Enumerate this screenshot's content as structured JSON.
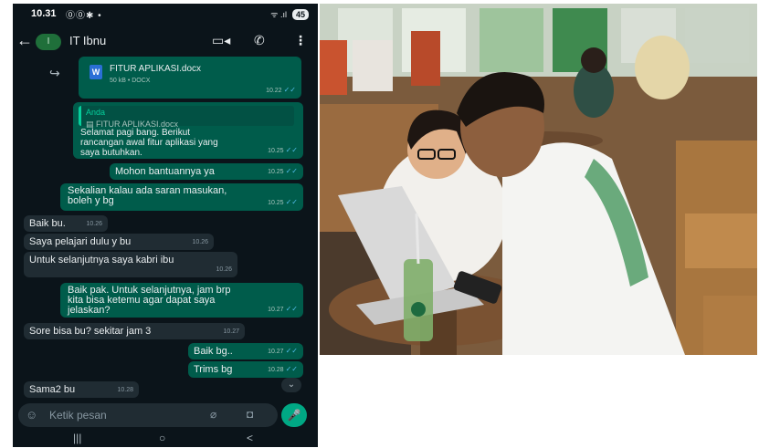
{
  "status_bar": {
    "time": "10.31",
    "icons": "⓪⓪✱ •",
    "signal": "ᯤ .ıl",
    "battery": "45"
  },
  "header": {
    "back": "←",
    "avatar_letter": "I",
    "contact_name": "IT Ibnu",
    "video_icon": "▭◂",
    "call_icon": "✆",
    "menu_icon": "⋮"
  },
  "messages": {
    "doc": {
      "forward_icon": "↪",
      "file_icon": "W",
      "name": "FITUR APLIKASI.docx",
      "size": "50 kB • DOCX",
      "time": "10.22"
    },
    "quoted": {
      "quote_author": "Anda",
      "quote_text": "▤ FITUR APLIKASI.docx",
      "line1": "Selamat pagi bang. Berikut",
      "line2": "rancangan awal fitur aplikasi yang",
      "line3": "saya butuhkan.",
      "time": "10.25"
    },
    "m1": {
      "text": "Mohon bantuannya ya",
      "time": "10.25"
    },
    "m2": {
      "line1": "Sekalian kalau ada saran masukan,",
      "line2": "boleh y bg",
      "time": "10.25"
    },
    "m3": {
      "text": "Baik bu.",
      "time": "10.26"
    },
    "m4": {
      "text": "Saya pelajari dulu y bu",
      "time": "10.26"
    },
    "m5": {
      "text": "Untuk selanjutnya saya kabri ibu",
      "time": "10.26"
    },
    "m6": {
      "line1": "Baik pak. Untuk selanjutnya, jam brp",
      "line2": "kita bisa ketemu agar dapat saya",
      "line3": "jelaskan?",
      "time": "10.27"
    },
    "m7": {
      "text": "Sore bisa bu? sekitar jam 3",
      "time": "10.27"
    },
    "m8": {
      "text": "Baik bg..",
      "time": "10.27"
    },
    "m9": {
      "text": "Trims bg",
      "time": "10.28"
    },
    "m10": {
      "text": "Sama2 bu",
      "time": "10.28"
    },
    "read_ticks": "✓✓"
  },
  "scroll_down_icon": "⌄",
  "input": {
    "emoji_icon": "☺",
    "placeholder": "Ketik pesan",
    "attach_icon": "⌀",
    "camera_icon": "◘",
    "mic_icon": "🎤"
  },
  "nav": {
    "recents": "|||",
    "home": "○",
    "back": "<"
  },
  "colors": {
    "chat_bg": "#0b141a",
    "outgoing": "#005c4b",
    "incoming": "#202c33",
    "accent": "#00a884",
    "ticks": "#53bdeb"
  }
}
